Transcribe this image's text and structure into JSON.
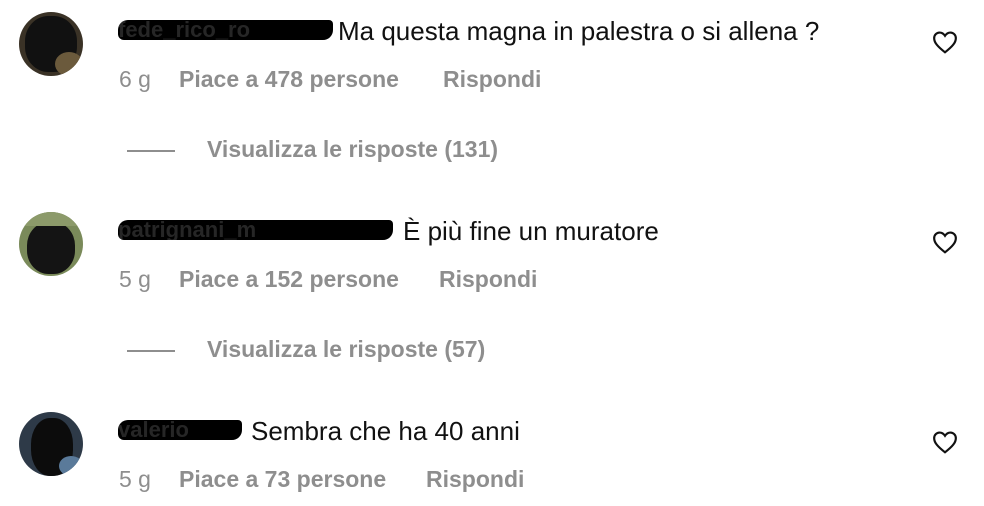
{
  "comments": [
    {
      "username": "fede_rico_ro",
      "text": "Ma questa magna in palestra o si allena ?",
      "time": "6 g",
      "likes": "Piace a 478 persone",
      "reply": "Rispondi",
      "view_replies": "Visualizza le risposte (131)"
    },
    {
      "username": "patrignani_m",
      "text": "È più fine un muratore",
      "time": "5 g",
      "likes": "Piace a 152 persone",
      "reply": "Rispondi",
      "view_replies": "Visualizza le risposte (57)"
    },
    {
      "username": "valerio",
      "text": "Sembra che ha 40 anni",
      "time": "5 g",
      "likes": "Piace a 73 persone",
      "reply": "Rispondi"
    }
  ],
  "icons": {
    "like": "heart-outline-icon"
  },
  "colors": {
    "meta_text": "#8e8e8e",
    "redaction": "#000000"
  }
}
